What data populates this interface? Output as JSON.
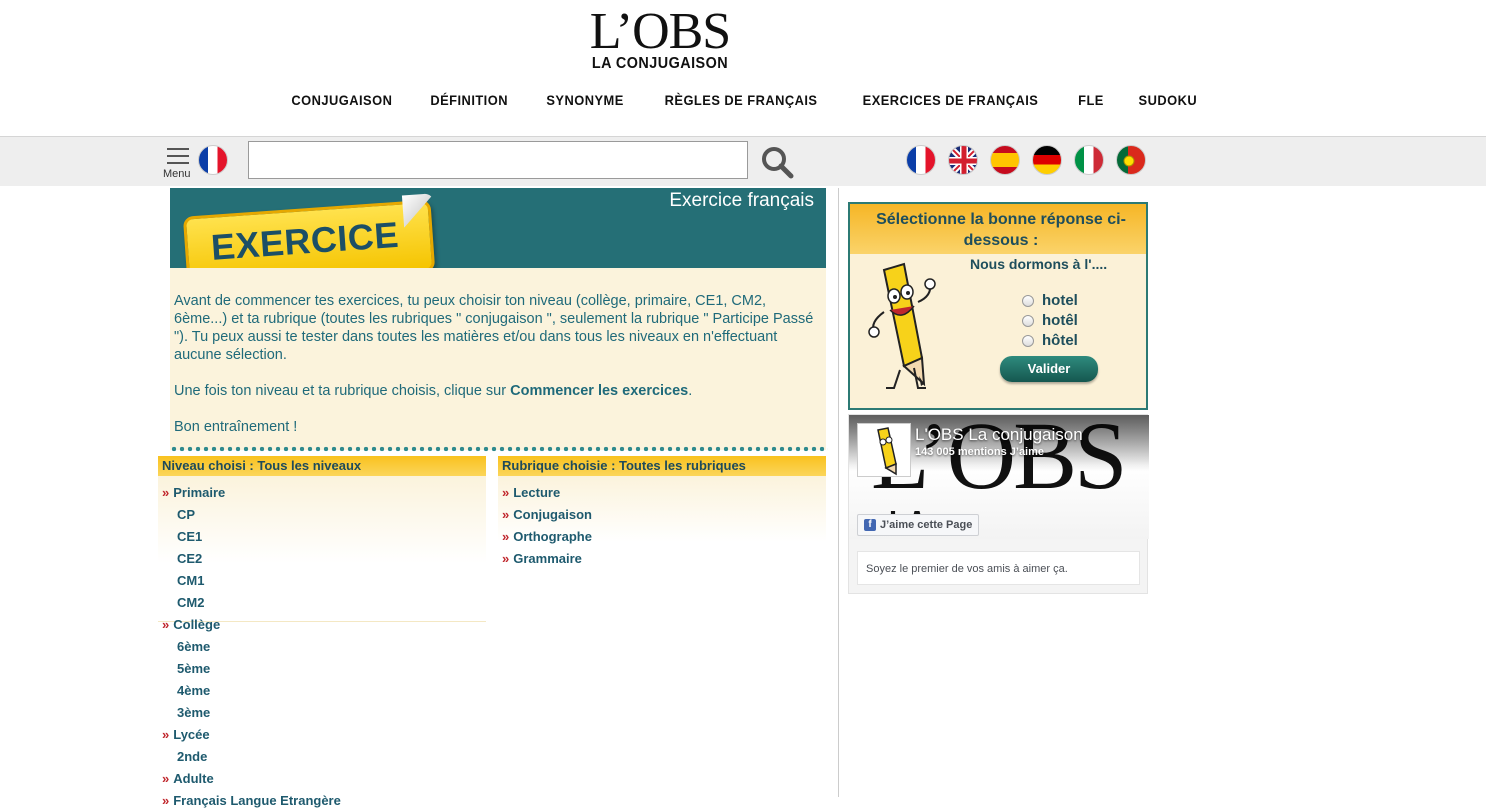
{
  "header": {
    "logo_main": "L’OBS",
    "logo_sub": "LA CONJUGAISON",
    "nav": [
      {
        "label": "CONJUGAISON"
      },
      {
        "label": "DÉFINITION"
      },
      {
        "label": "SYNONYME"
      },
      {
        "label": "RÈGLES DE FRANÇAIS"
      },
      {
        "label": "EXERCICES DE FRANÇAIS"
      },
      {
        "label": "FLE"
      },
      {
        "label": "SUDOKU"
      }
    ]
  },
  "toolbar": {
    "menu_label": "Menu",
    "current_language": "fr",
    "search_value": "",
    "languages": [
      "fr",
      "en",
      "es",
      "de",
      "it",
      "pt"
    ]
  },
  "exercise": {
    "banner_title": "Exercice français",
    "sticker_word": "EXERCICE",
    "intro_p1": "Avant de commencer tes exercices, tu peux choisir ton niveau (collège, primaire, CE1, CM2, 6ème...) et ta rubrique (toutes les rubriques \" conjugaison \", seulement la rubrique \" Participe Passé \"). Tu peux aussi te tester dans toutes les matières et/ou dans tous les niveaux en n'effectuant aucune sélection.",
    "intro_p2_prefix": "Une fois ton niveau et ta rubrique choisis, clique sur ",
    "intro_p2_link": "Commencer les exercices",
    "intro_p2_suffix": ".",
    "intro_p3": "Bon entraînement !"
  },
  "levels": {
    "heading": "Niveau choisi : Tous les niveaux",
    "items": [
      {
        "label": "Primaire",
        "top": true
      },
      {
        "label": "CP",
        "top": false
      },
      {
        "label": "CE1",
        "top": false
      },
      {
        "label": "CE2",
        "top": false
      },
      {
        "label": "CM1",
        "top": false
      },
      {
        "label": "CM2",
        "top": false
      },
      {
        "label": "Collège",
        "top": true
      },
      {
        "label": "6ème",
        "top": false
      },
      {
        "label": "5ème",
        "top": false
      },
      {
        "label": "4ème",
        "top": false
      },
      {
        "label": "3ème",
        "top": false
      },
      {
        "label": "Lycée",
        "top": true
      },
      {
        "label": "2nde",
        "top": false
      },
      {
        "label": "Adulte",
        "top": true
      },
      {
        "label": "Français Langue Etrangère",
        "top": true
      }
    ]
  },
  "rubrics": {
    "heading": "Rubrique choisie : Toutes les rubriques",
    "items": [
      "Lecture",
      "Conjugaison",
      "Orthographe",
      "Grammaire"
    ]
  },
  "quiz": {
    "title": "Sélectionne la bonne réponse ci-dessous :",
    "question": "Nous dormons à l'....",
    "options": [
      "hotel",
      "hotêl",
      "hôtel"
    ],
    "submit_label": "Valider"
  },
  "facebook": {
    "page_name": "L'OBS La conjugaison",
    "likes": "143 005 mentions J’aime",
    "cover_big": "L’OBS",
    "cover_small": "LA CONJUGAISON",
    "like_button": "J’aime cette Page",
    "friends_text": "Soyez le premier de vos amis à aimer ça."
  },
  "colors": {
    "teal": "#256f76",
    "cream": "#fbf3dc",
    "gold": "#f9c21f",
    "text_blue": "#1e5a6e",
    "arrow_red": "#c0272d"
  }
}
